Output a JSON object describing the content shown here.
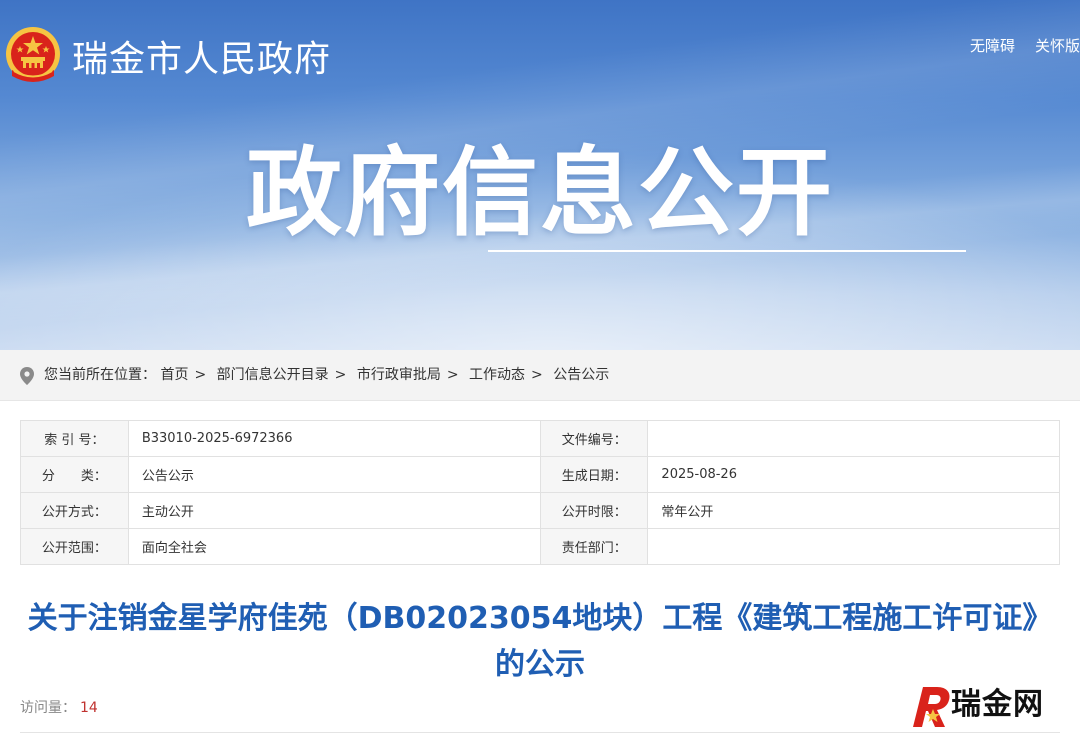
{
  "header": {
    "site_title": "瑞金市人民政府",
    "top_links": [
      "无障碍",
      "关怀版"
    ],
    "banner_title": "政府信息公开",
    "colors": {
      "banner_top": "#3f74c5",
      "banner_bottom": "#c9daf1",
      "emblem_red": "#d9231b",
      "emblem_gold": "#f6c443"
    }
  },
  "breadcrumb": {
    "prefix": "您当前所在位置：",
    "items": [
      "首页",
      "部门信息公开目录",
      "市行政审批局",
      "工作动态",
      "公告公示"
    ],
    "separator": ">"
  },
  "meta": {
    "rows": [
      [
        {
          "label": "索 引 号：",
          "value": "B33010-2025-6972366"
        },
        {
          "label": "文件编号：",
          "value": ""
        }
      ],
      [
        {
          "label": "分　　类：",
          "value": "公告公示"
        },
        {
          "label": "生成日期：",
          "value": "2025-08-26"
        }
      ],
      [
        {
          "label": "公开方式：",
          "value": "主动公开"
        },
        {
          "label": "公开时限：",
          "value": "常年公开"
        }
      ],
      [
        {
          "label": "公开范围：",
          "value": "面向全社会"
        },
        {
          "label": "责任部门：",
          "value": ""
        }
      ]
    ]
  },
  "article": {
    "title": "关于注销金星学府佳苑（DB02023054地块）工程《建筑工程施工许可证》的公示",
    "visits_label": "访问量：",
    "visits_count": "14",
    "title_color": "#1f5eb3"
  },
  "watermark": {
    "text": "瑞金网",
    "logo_color": "#d9231b"
  }
}
